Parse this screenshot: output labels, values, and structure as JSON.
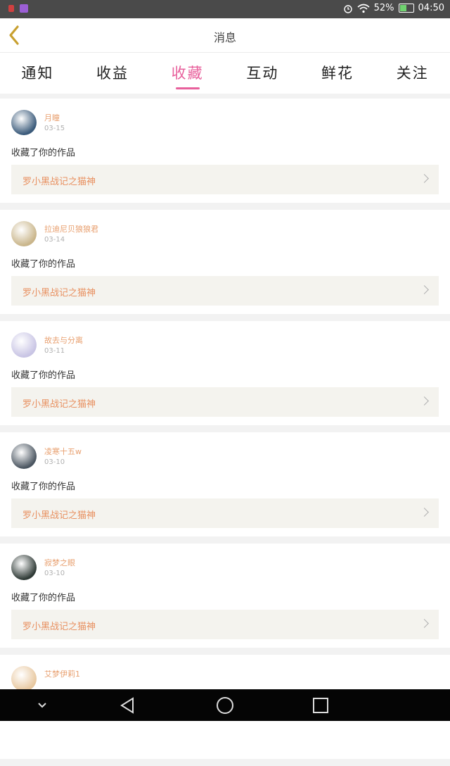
{
  "status_bar": {
    "battery_percent": "52%",
    "battery_level": 0.52,
    "time": "04:50",
    "icons": [
      "app-notification-icon",
      "app-notification-icon",
      "alarm-icon",
      "wifi-icon",
      "battery-icon"
    ]
  },
  "header": {
    "title": "消息",
    "back_icon": "chevron-left-icon"
  },
  "tabs": [
    {
      "label": "通知",
      "active": false
    },
    {
      "label": "收益",
      "active": false
    },
    {
      "label": "收藏",
      "active": true
    },
    {
      "label": "互动",
      "active": false
    },
    {
      "label": "鲜花",
      "active": false
    },
    {
      "label": "关注",
      "active": false
    }
  ],
  "colors": {
    "accent": "#e8609c",
    "username": "#e8a070",
    "work_title": "#e89060",
    "back_icon": "#c8a030"
  },
  "notifications": [
    {
      "user": "月瞳",
      "date": "03-15",
      "action": "收藏了你的作品",
      "work": "罗小黑战记之猫神",
      "avatar_color": "#3a5a7a"
    },
    {
      "user": "拉迪尼贝狼狼君",
      "date": "03-14",
      "action": "收藏了你的作品",
      "work": "罗小黑战记之猫神",
      "avatar_color": "#c9b58a"
    },
    {
      "user": "故去与分离",
      "date": "03-11",
      "action": "收藏了你的作品",
      "work": "罗小黑战记之猫神",
      "avatar_color": "#c8c4e4"
    },
    {
      "user": "凌寒十五w",
      "date": "03-10",
      "action": "收藏了你的作品",
      "work": "罗小黑战记之猫神",
      "avatar_color": "#4a5560"
    },
    {
      "user": "寂梦之眼",
      "date": "03-10",
      "action": "收藏了你的作品",
      "work": "罗小黑战记之猫神",
      "avatar_color": "#2f3a36"
    },
    {
      "user": "艾梦伊莉1",
      "date": "",
      "action": "",
      "work": "",
      "avatar_color": "#e8c8a0"
    }
  ]
}
